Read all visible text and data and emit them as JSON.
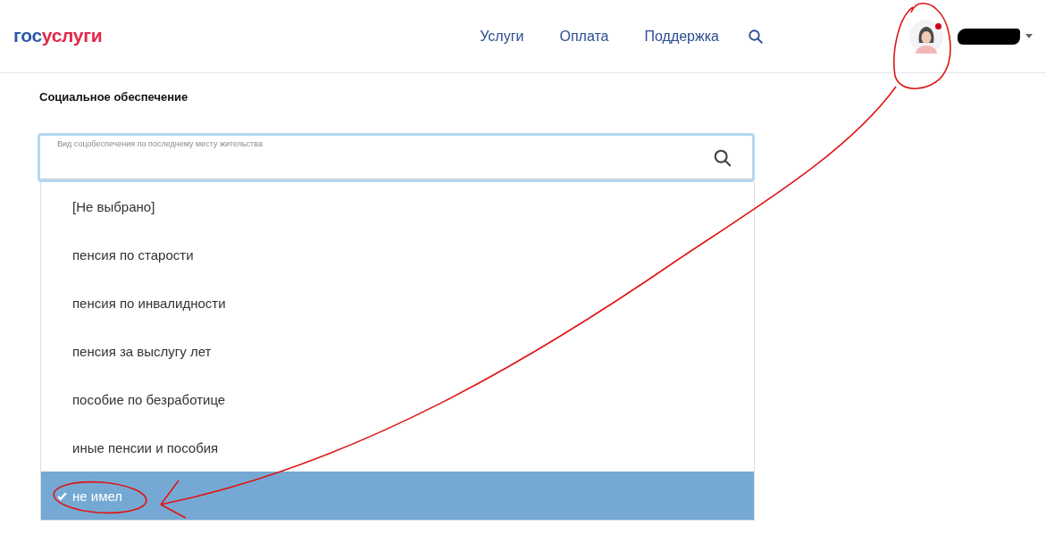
{
  "header": {
    "logo": [
      {
        "text": "гос",
        "color": "#2c5aa8"
      },
      {
        "text": "услуги",
        "color": "#e1284a"
      }
    ],
    "nav": [
      {
        "label": "Услуги"
      },
      {
        "label": "Оплата"
      },
      {
        "label": "Поддержка"
      }
    ],
    "user": {
      "notification": true
    }
  },
  "section_title": "Социальное обеспечение",
  "select": {
    "label": "Вид соцобеспечения по последнему месту жительства",
    "expanded": true,
    "options": [
      {
        "label": "[Не выбрано]",
        "selected": false
      },
      {
        "label": "пенсия по старости",
        "selected": false
      },
      {
        "label": "пенсия по инвалидности",
        "selected": false
      },
      {
        "label": "пенсия за выслугу лет",
        "selected": false
      },
      {
        "label": "пособие по безработице",
        "selected": false
      },
      {
        "label": "иные пенсии и пособия",
        "selected": false
      },
      {
        "label": "не имел",
        "selected": true
      }
    ]
  }
}
